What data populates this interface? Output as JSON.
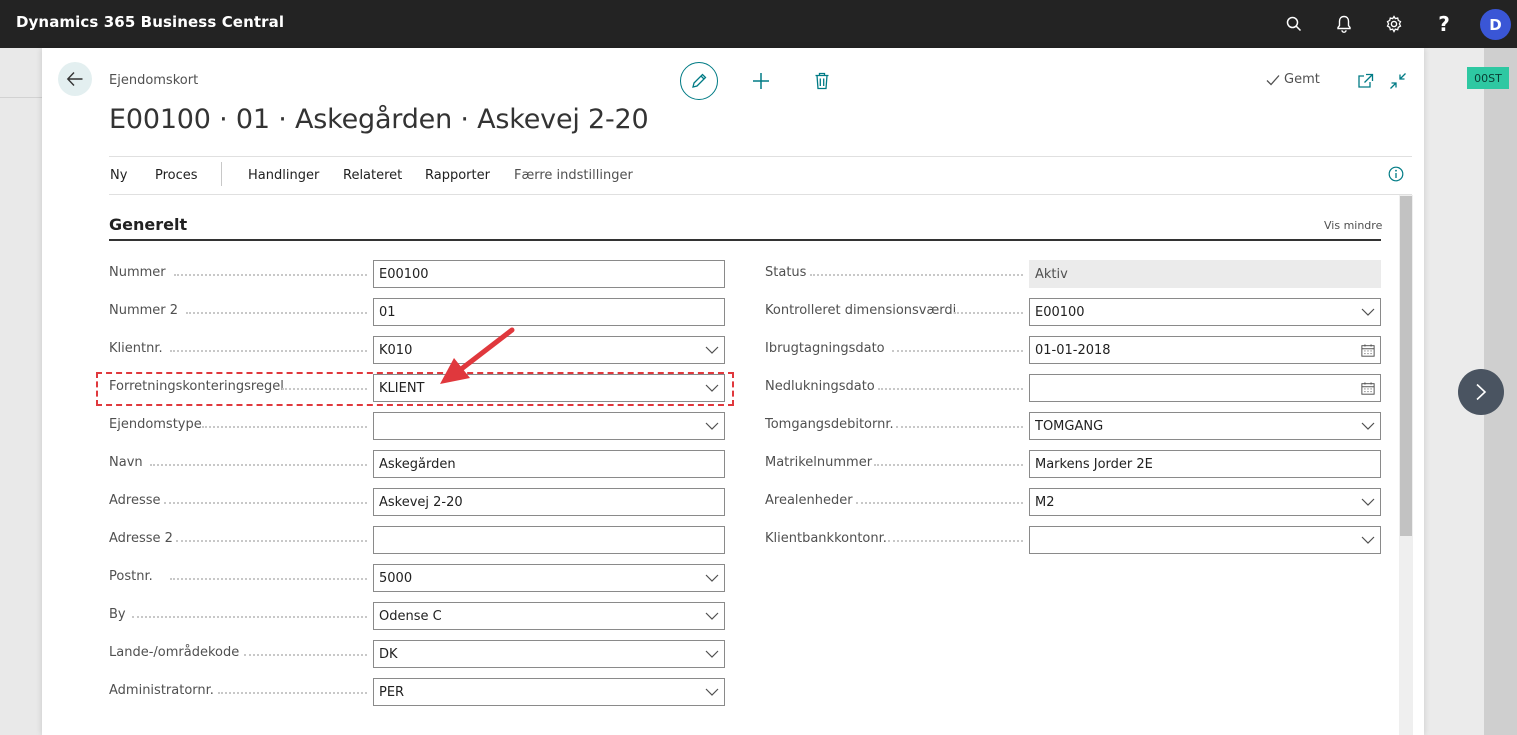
{
  "app": {
    "title": "Dynamics 365 Business Central",
    "user_initial": "D"
  },
  "env_badge": "00ST",
  "page": {
    "breadcrumb": "Ejendomskort",
    "title": "E00100 · 01 · Askegården · Askevej 2-20",
    "saved_label": "Gemt"
  },
  "menu": [
    "Ny",
    "Proces",
    "Handlinger",
    "Relateret",
    "Rapporter",
    "Færre indstillinger"
  ],
  "section": {
    "title": "Generelt",
    "toggle_label": "Vis mindre"
  },
  "left_fields": [
    {
      "label": "Nummer",
      "value": "E00100",
      "type": "text"
    },
    {
      "label": "Nummer 2",
      "value": "01",
      "type": "text"
    },
    {
      "label": "Klientnr.",
      "value": "K010",
      "type": "dropdown"
    },
    {
      "label": "Forretningskonteringsregel",
      "value": "KLIENT",
      "type": "dropdown"
    },
    {
      "label": "Ejendomstype",
      "value": "",
      "type": "dropdown"
    },
    {
      "label": "Navn",
      "value": "Askegården",
      "type": "text"
    },
    {
      "label": "Adresse",
      "value": "Askevej 2-20",
      "type": "text"
    },
    {
      "label": "Adresse 2",
      "value": "",
      "type": "text"
    },
    {
      "label": "Postnr.",
      "value": "5000",
      "type": "dropdown"
    },
    {
      "label": "By",
      "value": "Odense C",
      "type": "dropdown"
    },
    {
      "label": "Lande-/områdekode",
      "value": "DK",
      "type": "dropdown"
    },
    {
      "label": "Administratornr.",
      "value": "PER",
      "type": "dropdown"
    }
  ],
  "right_fields": [
    {
      "label": "Status",
      "value": "Aktiv",
      "type": "readonly"
    },
    {
      "label": "Kontrolleret dimensionsværdi",
      "value": "E00100",
      "type": "dropdown"
    },
    {
      "label": "Ibrugtagningsdato",
      "value": "01-01-2018",
      "type": "date"
    },
    {
      "label": "Nedlukningsdato",
      "value": "",
      "type": "date"
    },
    {
      "label": "Tomgangsdebitornr.",
      "value": "TOMGANG",
      "type": "dropdown"
    },
    {
      "label": "Matrikelnummer",
      "value": "Markens Jorder 2E",
      "type": "text"
    },
    {
      "label": "Arealenheder",
      "value": "M2",
      "type": "dropdown"
    },
    {
      "label": "Klientbankkontonr.",
      "value": "",
      "type": "dropdown"
    }
  ],
  "colors": {
    "accent": "#007b85",
    "topbar": "#232323",
    "highlight": "#e0383d",
    "avatar": "#3a56d6",
    "env_badge": "#2ec8a2"
  }
}
